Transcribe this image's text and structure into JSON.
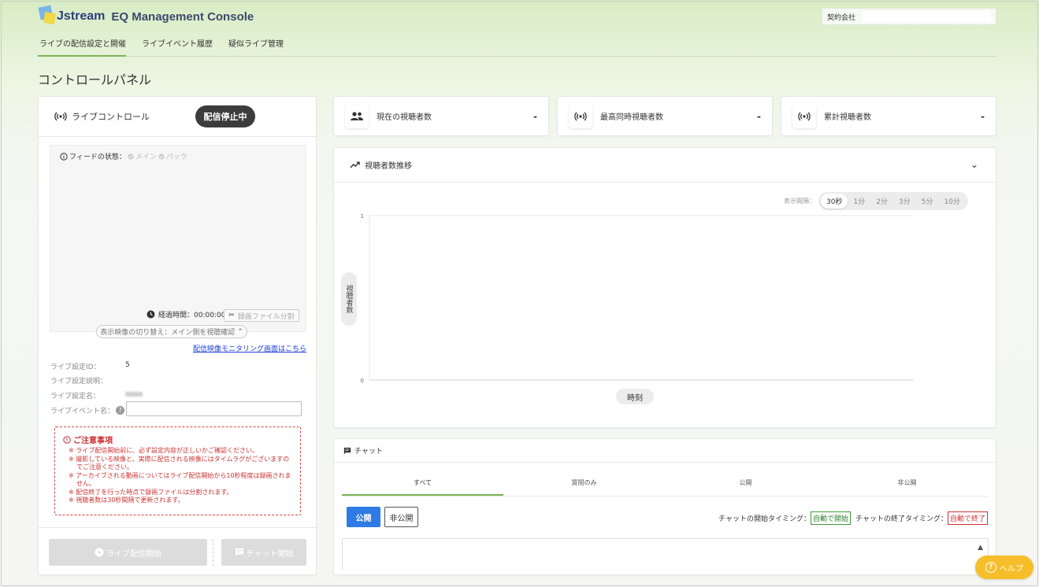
{
  "header": {
    "brand": "Jstream",
    "console_name": "EQ Management Console",
    "company_label": "契約会社",
    "company_value": ""
  },
  "nav": {
    "items": [
      {
        "label": "ライブの配信設定と開催",
        "active": true
      },
      {
        "label": "ライブイベント履歴",
        "active": false
      },
      {
        "label": "疑似ライブ管理",
        "active": false
      }
    ]
  },
  "page": {
    "title": "コントロールパネル"
  },
  "live_control": {
    "title": "ライブコントロール",
    "status": "配信停止中",
    "feed_status_label": "フィードの状態：",
    "feed_main": "メイン",
    "feed_back": "バック",
    "elapsed_label": "経過時間：00:00:00",
    "split_button": "録画ファイル分割",
    "switch_label": "表示映像の切り替え：メイン側を視聴確認",
    "monitor_link": "配信映像モニタリング画面はこちら",
    "info": {
      "setting_id_label": "ライブ設定ID：",
      "setting_id_value": "5",
      "setting_desc_label": "ライブ設定説明：",
      "setting_name_label": "ライブ設定名：",
      "event_name_label": "ライブイベント名：",
      "event_name_value": ""
    },
    "notice": {
      "title": "ご注意事項",
      "lines": [
        "※ ライブ配信開始前に、必ず設定内容が正しいかご確認ください。",
        "※ 撮影している映像と、実際に配信される映像にはタイムラグがございますの",
        "でご注意ください。",
        "※ アーカイブされる動画についてはライブ配信開始から10秒程度は録画されま",
        "せん。",
        "※ 配信終了を行った時点で録画ファイルは分割されます。",
        "※ 視聴者数は30秒間隔で更新されます。"
      ]
    },
    "start_button": "ライブ配信開始",
    "chat_start_button": "チャット開始"
  },
  "stats": [
    {
      "label": "現在の視聴者数",
      "value": "-",
      "icon": "people-icon"
    },
    {
      "label": "最高同時視聴者数",
      "value": "-",
      "icon": "broadcast-icon"
    },
    {
      "label": "累計視聴者数",
      "value": "-",
      "icon": "broadcast-icon"
    }
  ],
  "graph": {
    "title": "視聴者数推移",
    "interval_label": "表示間隔：",
    "intervals": [
      "30秒",
      "1分",
      "2分",
      "3分",
      "5分",
      "10分"
    ],
    "active_interval": "30秒"
  },
  "chart_data": {
    "type": "line",
    "title": "",
    "xlabel": "時刻",
    "ylabel": "視聴者数",
    "ylim": [
      0,
      1
    ],
    "yticks": [
      "1",
      "0"
    ],
    "series": [],
    "grid": true
  },
  "chat": {
    "title": "チャット",
    "tabs": [
      "すべて",
      "質問のみ",
      "公開",
      "非公開"
    ],
    "active_tab": "すべて",
    "public_button": "公開",
    "private_button": "非公開",
    "start_timing_label": "チャットの開始タイミング：",
    "start_timing_value": "自動で開始",
    "end_timing_label": "チャットの終了タイミング：",
    "end_timing_value": "自動で終了"
  },
  "help": {
    "label": "ヘルプ"
  }
}
